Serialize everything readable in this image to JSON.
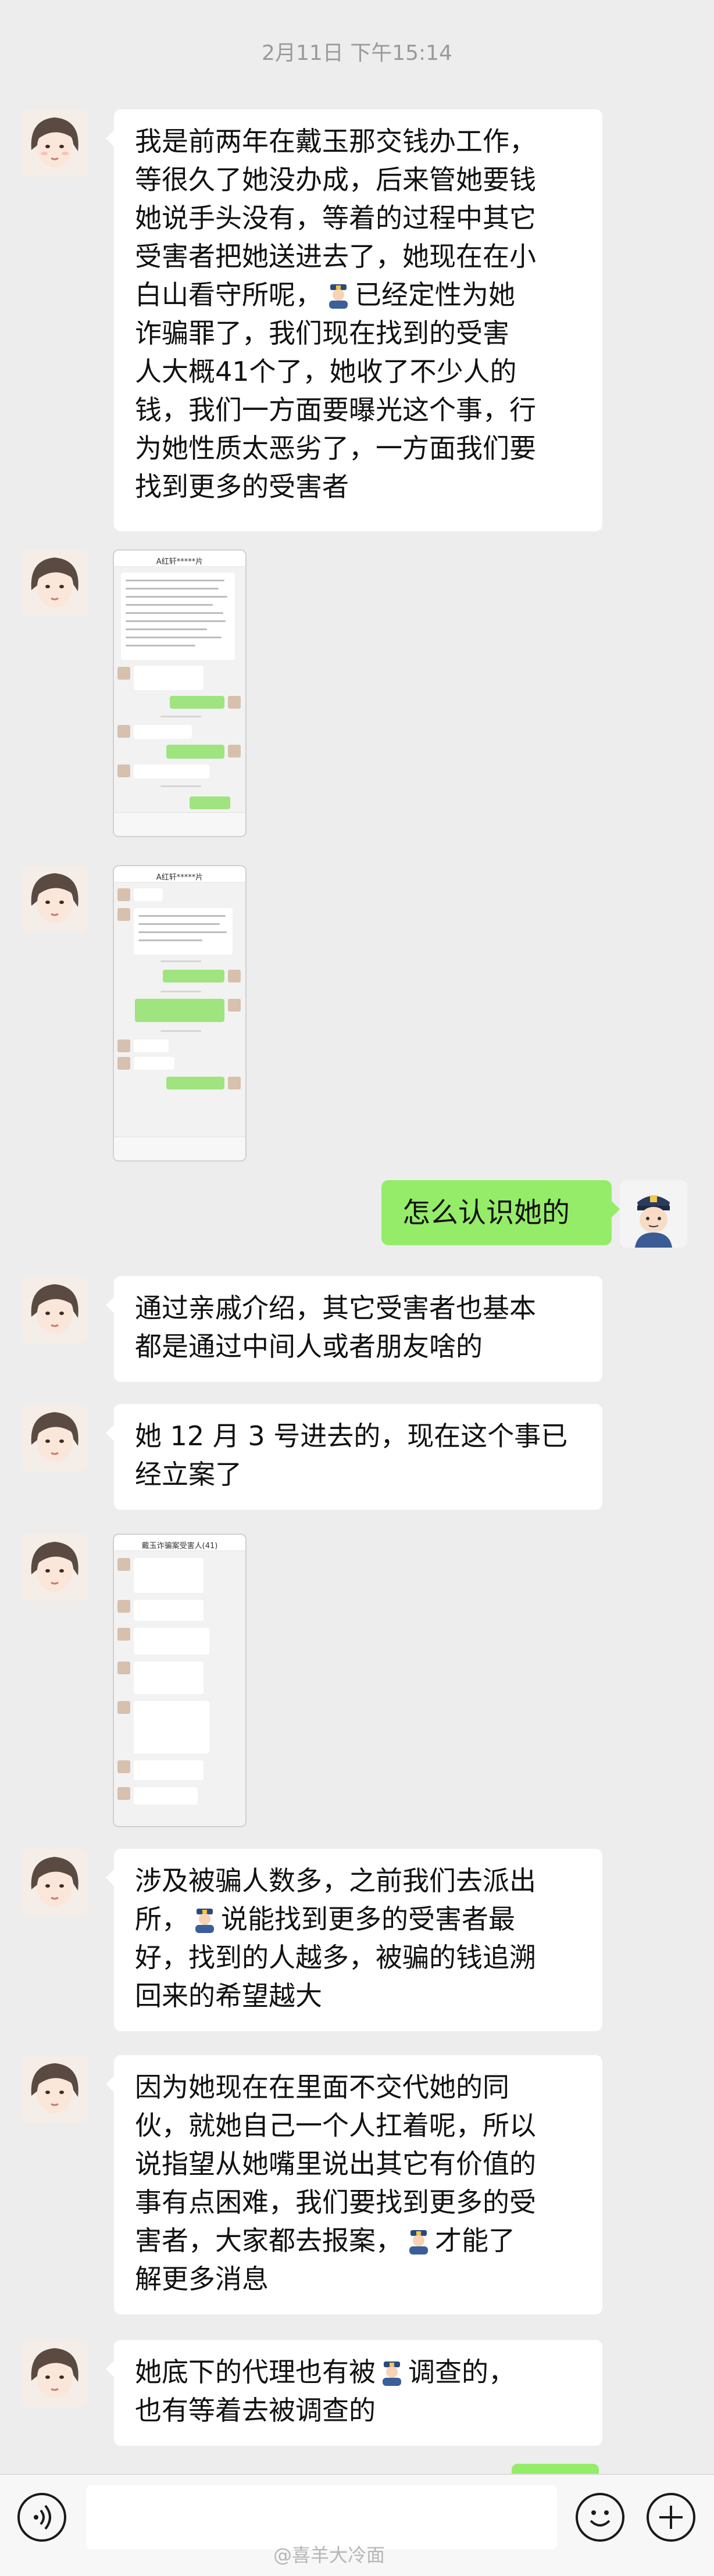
{
  "chat": {
    "timestamp": "2月11日 下午15:14",
    "messages": [
      {
        "lines": [
          "我是前两年在戴玉那交钱办工作，",
          "等很久了她没办成，后来管她要钱",
          "她说手头没有，等着的过程中其它",
          "受害者把她送进去了，她现在在小",
          "白山看守所呢，",
          "已经定性为她",
          "诈骗罪了，我们现在找到的受害",
          "人大概41个了，她收了不少人的",
          "钱，我们一方面要曝光这个事，行",
          "为她性质太恶劣了，一方面我们要",
          "找到更多的受害者"
        ]
      },
      {
        "text": "怎么认识她的"
      },
      {
        "lines": [
          "通过亲戚介绍，其它受害者也基本",
          "都是通过中间人或者朋友啥的"
        ]
      },
      {
        "lines": [
          "她 12 月 3 号进去的，现在这个事已",
          "经立案了"
        ]
      },
      {
        "lines": [
          "涉及被骗人数多，之前我们去派出",
          "所，",
          "说能找到更多的受害者最",
          "好，找到的人越多，被骗的钱追溯",
          "回来的希望越大"
        ]
      },
      {
        "lines": [
          "因为她现在在里面不交代她的同",
          "伙，就她自己一个人扛着呢，所以",
          "说指望从她嘴里说出其它有价值的",
          "事有点困难，我们要找到更多的受",
          "害者，大家都去报案，",
          "才能了",
          "解更多消息"
        ]
      },
      {
        "lines": [
          "她底下的代理也有被",
          "调查的，",
          "也有等着去被调查的"
        ]
      }
    ],
    "screenshots": [
      {
        "title": "A红轩*****片"
      },
      {
        "title": "A红轩*****片"
      },
      {
        "title": "戴玉诈骗案受害人(41)"
      }
    ]
  },
  "input_bar": {
    "voice_icon": "voice-icon",
    "emoji_icon": "emoji-icon",
    "plus_icon": "plus-icon",
    "watermark": "@喜羊大冷面"
  },
  "colors": {
    "background": "#ededed",
    "bubble_left": "#ffffff",
    "bubble_right": "#95ec69"
  }
}
